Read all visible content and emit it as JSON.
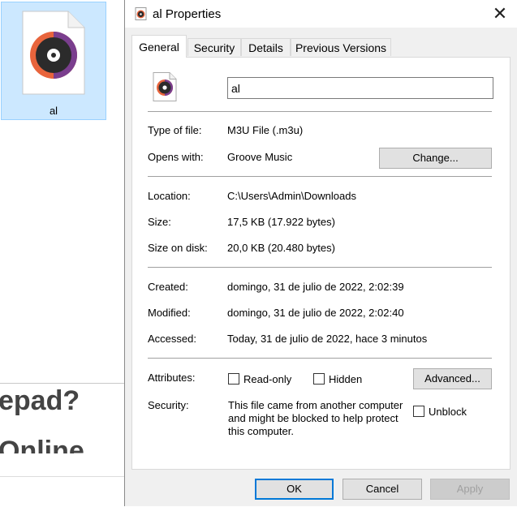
{
  "background": {
    "file_tile_label": "al",
    "heading_1": "epad?",
    "heading_2": "Online"
  },
  "window": {
    "title": "al Properties",
    "close_glyph": "✕",
    "tabs": [
      {
        "label": "General",
        "active": true
      },
      {
        "label": "Security",
        "active": false
      },
      {
        "label": "Details",
        "active": false
      },
      {
        "label": "Previous Versions",
        "active": false
      }
    ],
    "general": {
      "file_name": "al",
      "type_of_file_label": "Type of file:",
      "type_of_file_value": "M3U File (.m3u)",
      "opens_with_label": "Opens with:",
      "opens_with_value": "Groove Music",
      "change_button": "Change...",
      "location_label": "Location:",
      "location_value": "C:\\Users\\Admin\\Downloads",
      "size_label": "Size:",
      "size_value": "17,5 KB (17.922 bytes)",
      "size_on_disk_label": "Size on disk:",
      "size_on_disk_value": "20,0 KB (20.480 bytes)",
      "created_label": "Created:",
      "created_value": "domingo, 31 de julio de 2022, 2:02:39",
      "modified_label": "Modified:",
      "modified_value": "domingo, 31 de julio de 2022, 2:02:40",
      "accessed_label": "Accessed:",
      "accessed_value": "Today, 31 de julio de 2022, hace 3 minutos",
      "attributes_label": "Attributes:",
      "read_only_label": "Read-only",
      "read_only_checked": false,
      "hidden_label": "Hidden",
      "hidden_checked": false,
      "advanced_button": "Advanced...",
      "security_label": "Security:",
      "security_text_1": "This file came from another computer",
      "security_text_2": "and might be blocked to help protect",
      "security_text_3": "this computer.",
      "unblock_label": "Unblock",
      "unblock_checked": false
    },
    "buttons": {
      "ok": "OK",
      "cancel": "Cancel",
      "apply": "Apply"
    },
    "colors": {
      "accent": "#0078d7",
      "selection_bg": "#cce8ff",
      "groove_orange": "#e8643c",
      "groove_purple": "#7a3e8e"
    }
  }
}
